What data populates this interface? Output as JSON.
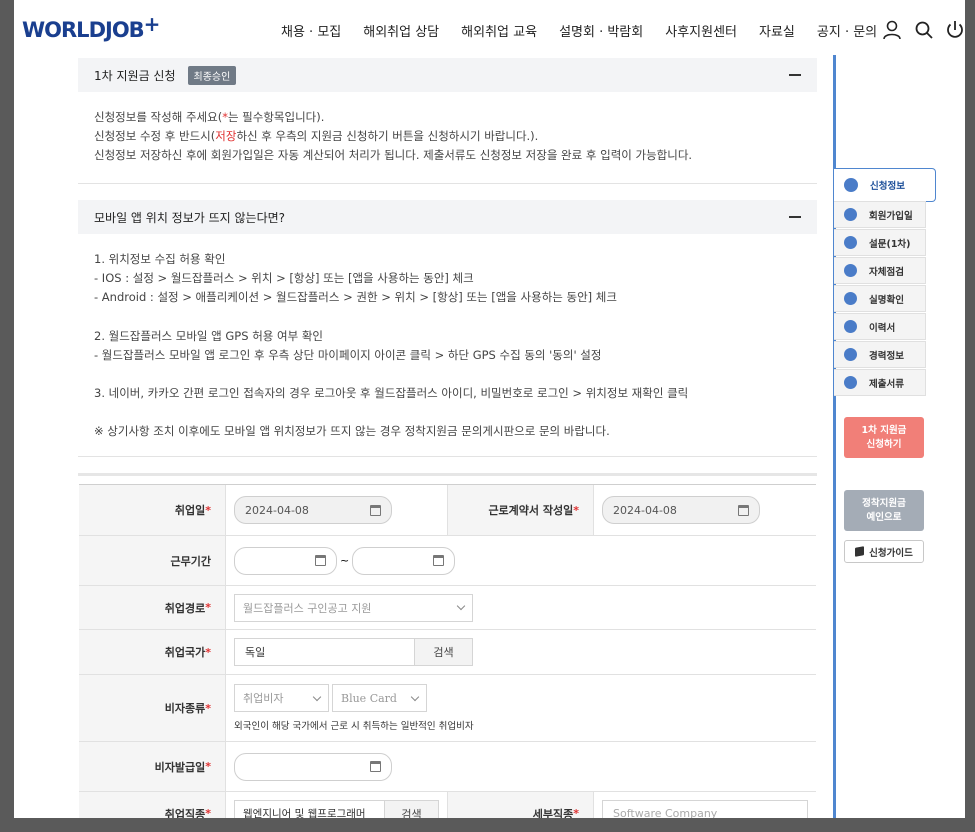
{
  "header": {
    "logo": "WORLDJOB",
    "logo_plus": "+",
    "nav": [
      "채용 · 모집",
      "해외취업 상담",
      "해외취업 교육",
      "설명회 · 박람회",
      "사후지원센터",
      "자료실",
      "공지 · 문의"
    ]
  },
  "section1": {
    "title": "1차 지원금 신청",
    "badge": "최종승인",
    "line1_a": "신청정보를 작성해 주세요(",
    "line1_star": "*",
    "line1_b": "는 필수항목입니다).",
    "line2_a": "신청정보 수정 후 반드시(",
    "line2_red": "저장",
    "line2_b": "하신 후 우측의 지원금 신청하기 버튼을 신청하시기 바랍니다.).",
    "line3": "신청정보 저장하신 후에 회원가입일은 자동 계산되어 처리가 됩니다. 제출서류도 신청정보 저장을 완료 후 입력이 가능합니다."
  },
  "section2": {
    "title": "모바일 앱 위치 정보가 뜨지 않는다면?",
    "lines": [
      "1. 위치정보 수집 허용 확인",
      "- IOS : 설정 > 월드잡플러스 > 위치 > [항상] 또는 [앱을 사용하는 동안] 체크",
      "- Android : 설정 > 애플리케이션 > 월드잡플러스 > 권한 > 위치 > [항상] 또는 [앱을 사용하는 동안] 체크",
      "",
      "2. 월드잡플러스 모바일 앱 GPS 허용 여부 확인",
      "- 월드잡플러스 모바일 앱 로그인 후 우측 상단 마이페이지 아이콘 클릭 > 하단 GPS 수집 동의 '동의' 설정",
      "",
      "3. 네이버, 카카오 간편 로그인 접속자의 경우 로그아웃 후 월드잡플러스 아이디, 비밀번호로 로그인 > 위치정보 재확인 클릭",
      "",
      "※ 상기사항 조치 이후에도 모바일 앱 위치정보가 뜨지 않는 경우 정착지원금 문의게시판으로 문의 바랍니다."
    ]
  },
  "form": {
    "employ_date_label": "취업일",
    "employ_date": "2024-04-08",
    "contract_date_label": "근로계약서 작성일",
    "contract_date": "2024-04-08",
    "work_period_label": "근무기간",
    "work_period_sep": "~",
    "route_label": "취업경로",
    "route_value": "월드잡플러스 구인공고 지원",
    "country_label": "취업국가",
    "country_value": "독일",
    "search": "검색",
    "visa_label": "비자종류",
    "visa_type": "취업비자",
    "visa_sub": "Blue Card",
    "visa_note": "외국인이 해당 국가에서 근로 시 취득하는 일반적인 취업비자",
    "visa_date_label": "비자발급일",
    "job_label": "취업직종",
    "job_value": "웹엔지니어 및 웹프로그래머",
    "detail_label": "세부직종",
    "detail_placeholder": "Software Company",
    "required_mark": "*"
  },
  "sidebar": {
    "items": [
      "신청정보",
      "회원가입일",
      "설문(1차)",
      "자체점검",
      "실명확인",
      "이력서",
      "경력정보",
      "제출서류"
    ],
    "apply_line1": "1차 지원금",
    "apply_line2": "신청하기",
    "pay_line1": "정착지원금",
    "pay_line2": "예인으로",
    "guide": "신청가이드"
  },
  "colors": {
    "brand": "#1a3f8f",
    "accent": "#4f86cf",
    "required": "#e03131",
    "apply_button": "#f17f78"
  }
}
